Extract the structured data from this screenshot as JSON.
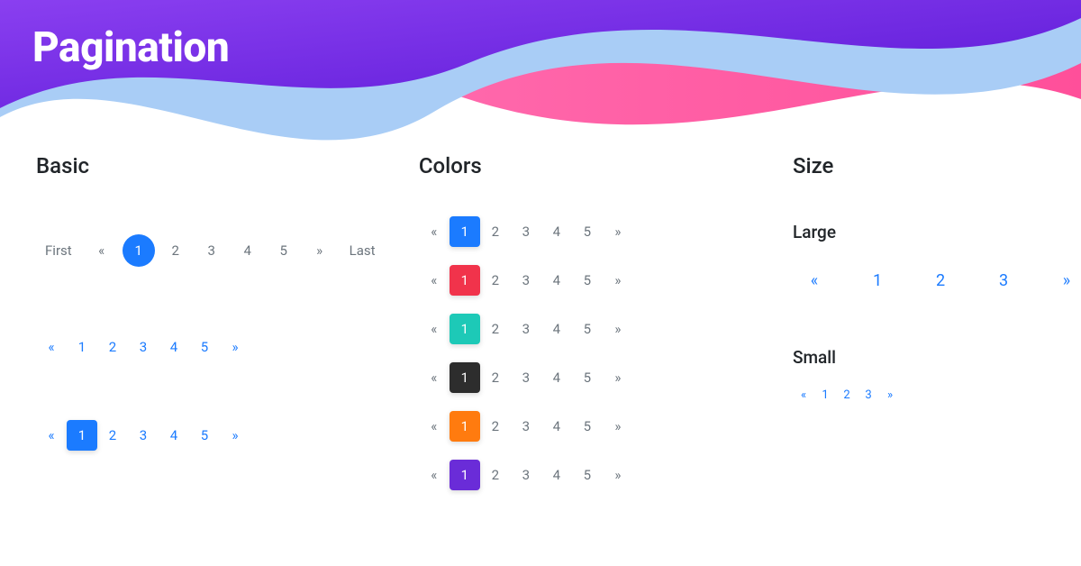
{
  "title": "Pagination",
  "sections": {
    "basic": {
      "title": "Basic"
    },
    "colors": {
      "title": "Colors"
    },
    "size": {
      "title": "Size",
      "large": "Large",
      "small": "Small"
    }
  },
  "labels": {
    "first": "First",
    "last": "Last",
    "prev": "«",
    "next": "»"
  },
  "pages": {
    "p1": "1",
    "p2": "2",
    "p3": "3",
    "p4": "4",
    "p5": "5"
  },
  "colors": {
    "blue": "#1b7bff",
    "red": "#f1334b",
    "teal": "#1dc9b7",
    "dark": "#2d2d2d",
    "orange": "#ff7b0f",
    "purple": "#6a2cd8"
  }
}
